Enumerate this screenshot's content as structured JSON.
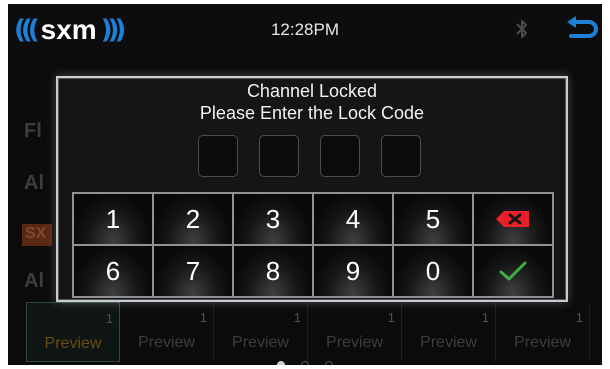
{
  "status_bar": {
    "brand": "sxm",
    "time": "12:28PM",
    "bluetooth_icon": "bluetooth-icon",
    "back_icon": "back-arrow-icon",
    "accent_color": "#1e7fd6"
  },
  "background": {
    "rows": [
      "Fl",
      "Al",
      "SX",
      "Al"
    ],
    "presets": [
      {
        "number": "1",
        "label": "Preview"
      },
      {
        "number": "1",
        "label": "Preview"
      },
      {
        "number": "1",
        "label": "Preview"
      },
      {
        "number": "1",
        "label": "Preview"
      },
      {
        "number": "1",
        "label": "Preview"
      },
      {
        "number": "1",
        "label": "Preview"
      }
    ],
    "page_dots": 3
  },
  "modal": {
    "title": "Channel Locked",
    "subtitle": "Please Enter the Lock Code",
    "code_slots": 4,
    "keypad": {
      "row1": [
        "1",
        "2",
        "3",
        "4",
        "5"
      ],
      "row2": [
        "6",
        "7",
        "8",
        "9",
        "0"
      ],
      "delete_icon": "backspace-icon",
      "confirm_icon": "checkmark-icon",
      "delete_color": "#e8202a",
      "confirm_color": "#3cb043"
    }
  }
}
